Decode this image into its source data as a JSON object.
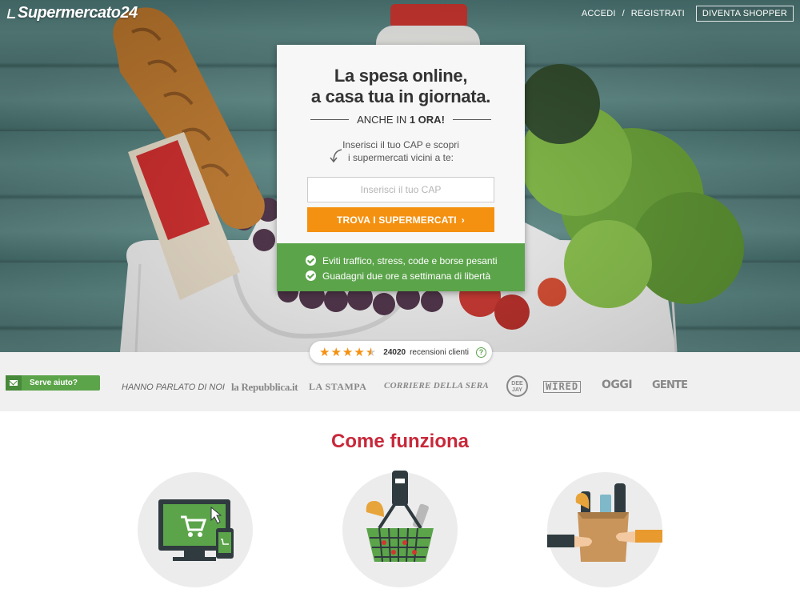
{
  "header": {
    "logo": "Supermercato24",
    "nav": {
      "login": "ACCEDI",
      "separator": "/",
      "register": "REGISTRATI",
      "shopper": "DIVENTA SHOPPER"
    }
  },
  "hero": {
    "title_line1": "La spesa online,",
    "title_line2": "a casa tua in giornata.",
    "subtitle_prefix": "ANCHE IN",
    "subtitle_bold": "1 ORA!",
    "cap_help_line1": "Inserisci il tuo CAP e scopri",
    "cap_help_line2": "i supermercati vicini a te:",
    "cap_placeholder": "Inserisci il tuo CAP",
    "cap_value": "",
    "find_button": "TROVA I SUPERMERCATI",
    "find_button_chevron": "›",
    "benefits": [
      "Eviti traffico, stress, code e borse pesanti",
      "Guadagni due ore a settimana di libertà"
    ]
  },
  "reviews": {
    "rating_stars": 4.5,
    "count": "24020",
    "label": "recensioni clienti",
    "help_icon": "?"
  },
  "press": {
    "help_button": "Serve aiuto?",
    "label": "HANNO PARLATO DI NOI",
    "outlets": {
      "repubblica": "la Repubblica.it",
      "stampa": "LA STAMPA",
      "corriere": "CORRIERE DELLA SERA",
      "deejay_line1": "DEE",
      "deejay_line2": "JAY",
      "wired": "WIRED",
      "oggi": "OGGI",
      "gente": "GENTE"
    }
  },
  "how_it_works": {
    "title": "Come funziona",
    "steps": [
      {
        "icon": "computer-cart-icon"
      },
      {
        "icon": "grocery-basket-icon"
      },
      {
        "icon": "delivery-bag-icon"
      }
    ]
  },
  "colors": {
    "accent_orange": "#f59110",
    "accent_green": "#5ba44a",
    "title_red": "#c8283a"
  }
}
